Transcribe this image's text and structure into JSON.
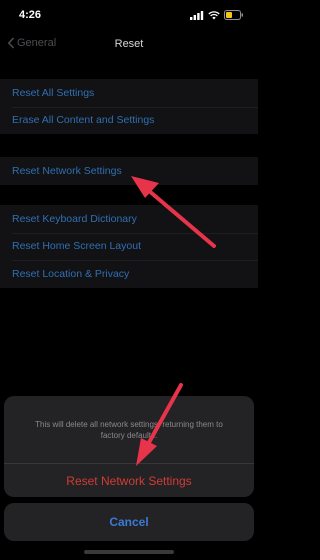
{
  "status_bar": {
    "time": "4:26",
    "icons": [
      "signal-icon",
      "wifi-icon",
      "battery-icon"
    ],
    "battery_color": "#f5c518"
  },
  "nav": {
    "back_label": "General",
    "title": "Reset"
  },
  "settings": {
    "group1": [
      "Reset All Settings",
      "Erase All Content and Settings"
    ],
    "group2": [
      "Reset Network Settings"
    ],
    "group3": [
      "Reset Keyboard Dictionary",
      "Reset Home Screen Layout",
      "Reset Location & Privacy"
    ]
  },
  "action_sheet": {
    "message": "This will delete all network settings, returning them to factory defaults.",
    "destructive_label": "Reset Network Settings",
    "cancel_label": "Cancel"
  },
  "colors": {
    "link": "#2f6fb3",
    "destructive": "#d23b35",
    "cancel": "#3b7ad6",
    "annotation_arrow": "#e8344a"
  }
}
